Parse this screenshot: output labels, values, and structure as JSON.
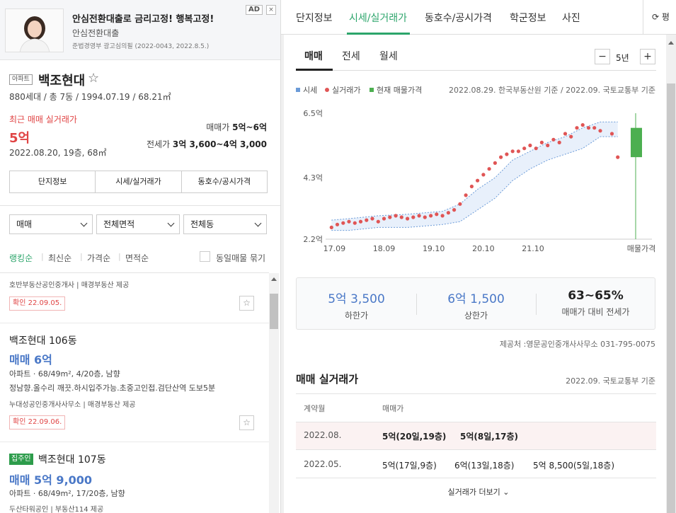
{
  "ad": {
    "title": "안심전환대출로 금리고정! 행복고정!",
    "subtitle": "안심전환대출",
    "note": "준법경영부 광고심의필 (2022-0043, 2022.8.5.)",
    "badge": "AD",
    "info_icon": "×"
  },
  "apartment": {
    "type_badge": "아파트",
    "name": "백조현대",
    "star": "☆",
    "meta": "880세대 / 총 7동 / 1994.07.19 / 68.21㎡",
    "recent_label": "최근 매매 실거래가",
    "recent_price": "5억",
    "recent_date": "2022.08.20, 19층, 68㎡",
    "sale_range_label": "매매가 ",
    "sale_range_value": "5억~6억",
    "jeonse_range_label": "전세가 ",
    "jeonse_range_value": "3억 3,600~4억 3,000"
  },
  "tab_buttons": [
    "단지정보",
    "시세/실거래가",
    "동호수/공시가격"
  ],
  "filters": [
    "매매",
    "전체면적",
    "전체동"
  ],
  "sort": {
    "options": [
      "랭킹순",
      "최신순",
      "가격순",
      "면적순"
    ],
    "checkbox_label": "동일매물 묶기"
  },
  "listings": {
    "top_agents": "호반부동산공인중개사 | 매경부동산 제공",
    "top_confirm": "확인 22.09.05.",
    "item1": {
      "name": "백조현대 106동",
      "price": "매매 6억",
      "detail1": "아파트 · 68/49m², 4/20층, 남향",
      "detail2": "정남향.올수리 깨끗.하시입주가능.초중고인접.검단산역 도보5분",
      "agents": "누대성공인중개사사무소 | 매경부동산 제공",
      "confirm": "확인 22.09.06."
    },
    "item2": {
      "badge": "집주인",
      "name": "백조현대 107동",
      "price": "매매 5억 9,000",
      "detail1": "아파트 · 68/49m², 17/20층, 남향",
      "agents": "두산타워공인 | 부동산114 제공"
    },
    "star": "☆"
  },
  "right_nav": {
    "tabs": [
      "단지정보",
      "시세/실거래가",
      "동호수/공시가격",
      "학군정보",
      "사진"
    ],
    "more": "⟳ 평"
  },
  "subtabs": [
    "매매",
    "전세",
    "월세"
  ],
  "period": {
    "minus": "−",
    "label": "5년",
    "plus": "+"
  },
  "legend": {
    "price": "시세",
    "real": "실거래가",
    "current": "현재 매물가격"
  },
  "chart_source": "2022.08.29. 한국부동산원 기준 / 2022.09. 국토교통부 기준",
  "chart_data": {
    "type": "scatter",
    "title": "",
    "xlabel": "",
    "ylabel": "",
    "x_ticks": [
      "17.09",
      "18.09",
      "19.10",
      "20.10",
      "21.10",
      "매물가격"
    ],
    "y_ticks": [
      "2.2억",
      "4.3억",
      "6.5억"
    ],
    "ylim": [
      2.2,
      6.5
    ],
    "series": [
      {
        "name": "시세",
        "type": "band",
        "x": [
          2017.7,
          2018.0,
          2018.5,
          2019.0,
          2019.3,
          2019.6,
          2019.9,
          2020.2,
          2020.5,
          2020.8,
          2021.1,
          2021.4,
          2021.7,
          2022.0,
          2022.3,
          2022.6
        ],
        "low": [
          2.5,
          2.5,
          2.6,
          2.6,
          2.65,
          2.7,
          2.8,
          3.2,
          3.6,
          4.2,
          4.6,
          4.9,
          5.1,
          5.3,
          5.7,
          5.7
        ],
        "high": [
          2.85,
          2.9,
          3.0,
          3.05,
          3.1,
          3.15,
          3.4,
          3.9,
          4.3,
          4.9,
          5.2,
          5.5,
          5.7,
          6.0,
          6.2,
          6.2
        ]
      },
      {
        "name": "실거래가",
        "type": "scatter",
        "x": [
          2017.7,
          2017.8,
          2017.9,
          2018.0,
          2018.1,
          2018.2,
          2018.3,
          2018.4,
          2018.5,
          2018.6,
          2018.7,
          2018.8,
          2018.9,
          2019.0,
          2019.1,
          2019.2,
          2019.3,
          2019.4,
          2019.5,
          2019.6,
          2019.7,
          2019.8,
          2019.9,
          2020.0,
          2020.1,
          2020.2,
          2020.3,
          2020.4,
          2020.5,
          2020.6,
          2020.7,
          2020.8,
          2020.9,
          2021.0,
          2021.1,
          2021.2,
          2021.3,
          2021.4,
          2021.5,
          2021.6,
          2021.7,
          2021.8,
          2021.9,
          2022.0,
          2022.1,
          2022.2,
          2022.3,
          2022.5,
          2022.6
        ],
        "y": [
          2.6,
          2.7,
          2.75,
          2.8,
          2.75,
          2.8,
          2.85,
          2.9,
          2.8,
          2.9,
          2.95,
          3.0,
          2.95,
          2.9,
          2.95,
          3.0,
          2.95,
          3.0,
          3.05,
          3.0,
          3.1,
          3.2,
          3.4,
          3.7,
          4.0,
          4.2,
          4.4,
          4.6,
          4.8,
          5.0,
          5.1,
          5.2,
          5.2,
          5.3,
          5.4,
          5.3,
          5.5,
          5.4,
          5.6,
          5.5,
          5.8,
          5.7,
          6.0,
          6.1,
          6.0,
          6.0,
          5.9,
          5.8,
          5.0
        ]
      },
      {
        "name": "현재 매물가격",
        "type": "range",
        "low": 5.0,
        "high": 6.0
      }
    ]
  },
  "stats": [
    {
      "value": "5억 3,500",
      "label": "하한가",
      "color": "#4a78c7"
    },
    {
      "value": "6억 1,500",
      "label": "상한가",
      "color": "#4a78c7"
    },
    {
      "value": "63~65%",
      "label": "매매가 대비 전세가",
      "color": "#222222"
    }
  ],
  "provider": "제공처 :영문공인중개사사무소 031-795-0075",
  "trades": {
    "title": "매매 실거래가",
    "source": "2022.09. 국토교통부 기준",
    "col_date": "계약월",
    "col_price": "매매가",
    "rows": [
      {
        "date": "2022.08.",
        "prices": [
          "5억(20일,19층)",
          "5억(8일,17층)"
        ]
      },
      {
        "date": "2022.05.",
        "prices": [
          "5억(17일,9층)",
          "6억(13일,18층)",
          "5억 8,500(5일,18층)"
        ]
      }
    ],
    "more": "실거래가 더보기 ⌄"
  },
  "colors": {
    "accent_green": "#2ca56b",
    "price_red": "#e04545",
    "price_blue": "#4a78c7",
    "dot_red": "#e05555",
    "band_blue": "#e8f0fb"
  }
}
